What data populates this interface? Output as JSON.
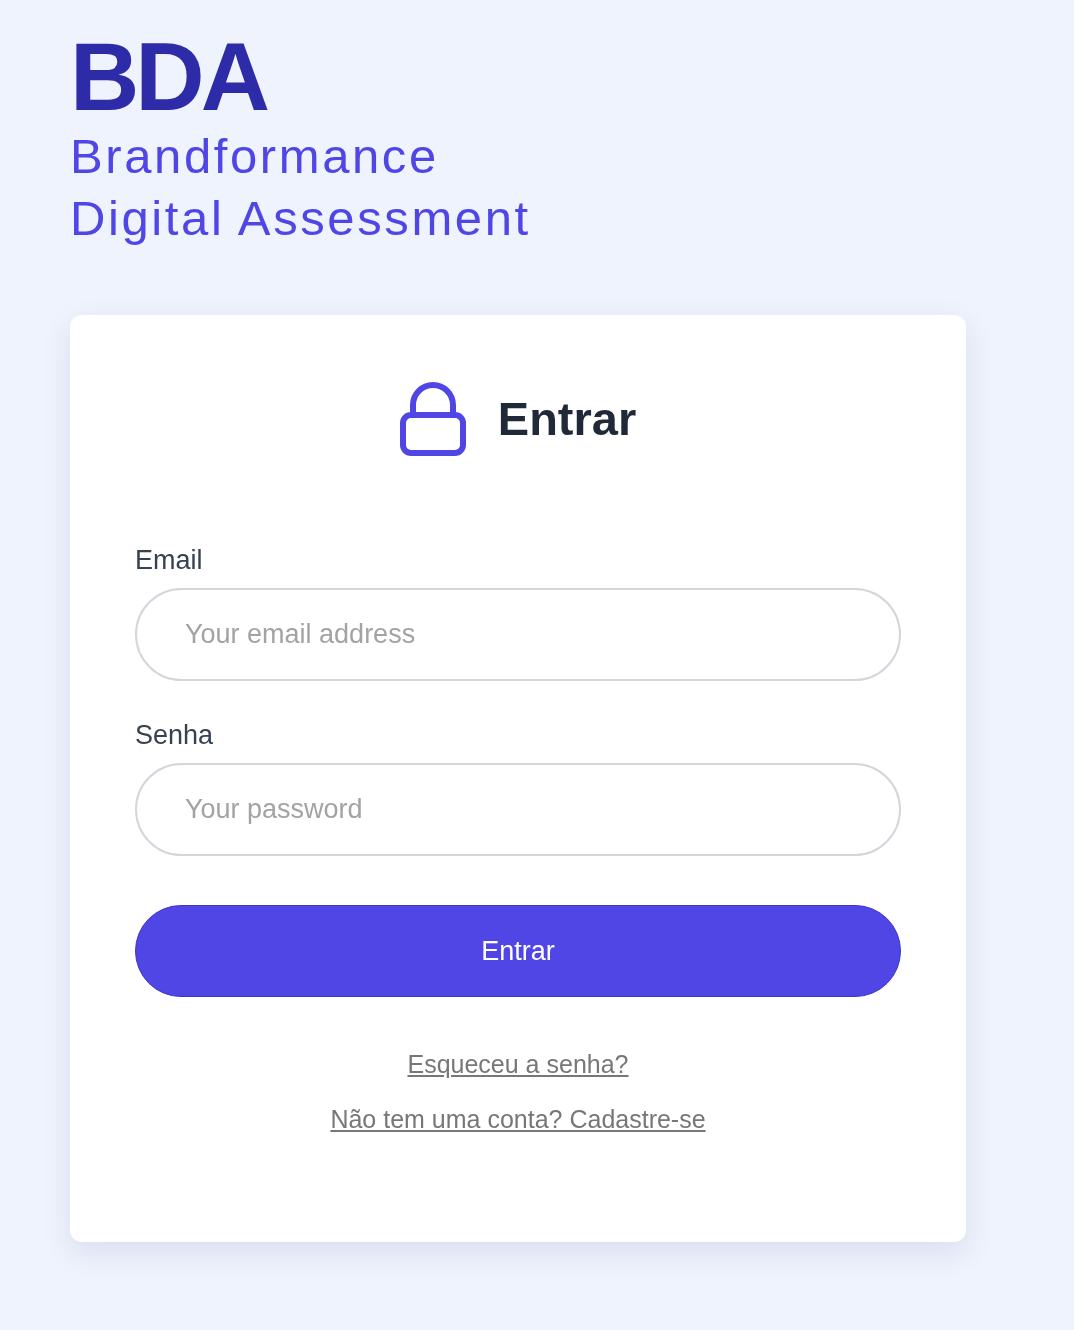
{
  "brand": {
    "logo": "BDA",
    "subtitle_lines": [
      "Brandformance",
      "Digital Assessment"
    ]
  },
  "login_card": {
    "title": "Entrar",
    "fields": [
      {
        "label": "Email",
        "placeholder": "Your email address"
      },
      {
        "label": "Senha",
        "placeholder": "Your password"
      }
    ],
    "submit_button": "Entrar",
    "links": [
      "Esqueceu a senha?",
      "Não tem uma conta? Cadastre-se"
    ]
  }
}
